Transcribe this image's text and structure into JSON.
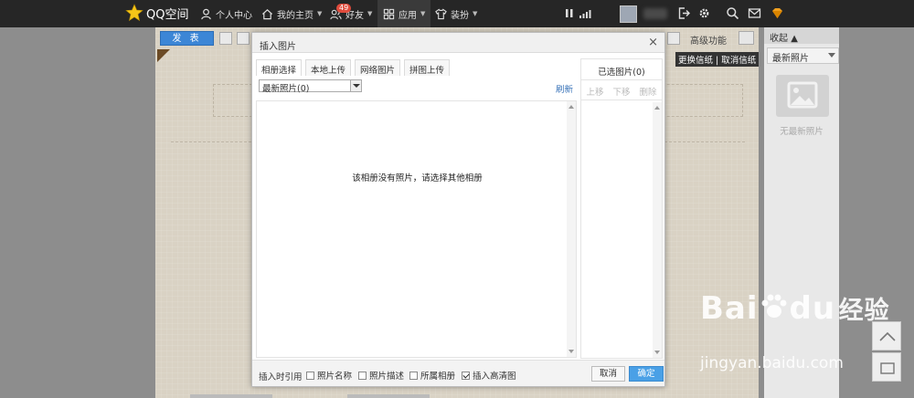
{
  "nav": {
    "logo": "QQ空间",
    "personal": "个人中心",
    "home": "我的主页",
    "friends": "好友",
    "friends_badge": "49",
    "apps": "应用",
    "decor": "装扮"
  },
  "editor": {
    "publish": "发 表",
    "advanced": "高级功能",
    "paper_links": "更换信纸 | 取消信纸"
  },
  "sidebar": {
    "collapse": "收起",
    "recent": "最新照片",
    "no_recent": "无最新照片"
  },
  "dialog": {
    "title": "插入图片",
    "close": "×",
    "tabs": [
      "相册选择",
      "本地上传",
      "网络图片",
      "拼图上传"
    ],
    "album_select": "最新照片(0)",
    "refresh": "刷新",
    "empty_message": "该相册没有照片，请选择其他相册",
    "selected_title": "已选图片(0)",
    "move_up": "上移",
    "move_down": "下移",
    "delete": "删除",
    "footer_label": "插入时引用",
    "options": [
      {
        "label": "照片名称",
        "checked": false
      },
      {
        "label": "照片描述",
        "checked": false
      },
      {
        "label": "所属相册",
        "checked": false
      },
      {
        "label": "插入高清图",
        "checked": true
      }
    ],
    "cancel": "取消",
    "confirm": "确定"
  },
  "watermark": {
    "brand": "Bai",
    "brand2": "du",
    "brand_cn": "经验",
    "url": "jingyan.baidu.com"
  },
  "colors": {
    "topbar": "#262626",
    "accent": "#4aa0e6",
    "badge": "#e04b3c"
  }
}
